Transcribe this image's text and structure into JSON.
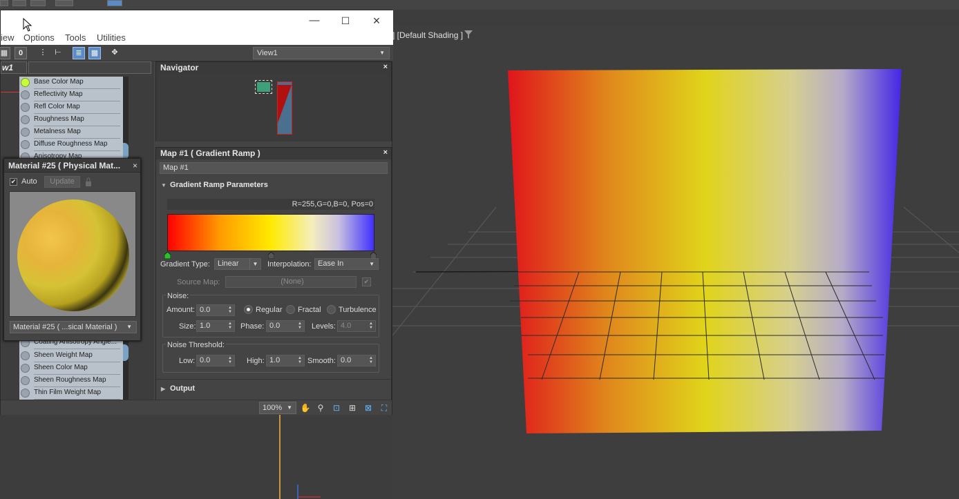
{
  "app": {
    "viewport_label": "] [Default Shading ]",
    "axis_label": "z"
  },
  "slate": {
    "menu": [
      "iew",
      "Options",
      "Tools",
      "Utilities"
    ],
    "toolbar_zero": "0",
    "view_select": "View1",
    "view_tab": "w1"
  },
  "node_slots_top": [
    "Base Color Map",
    "Reflectivity Map",
    "Refl Color Map",
    "Roughness Map",
    "Metalness Map",
    "Diffuse Roughness Map",
    "Anisotropy Map"
  ],
  "node_slots_bottom": [
    "Coating Anisotropy Angle...",
    "Sheen Weight Map",
    "Sheen Color Map",
    "Sheen Roughness Map",
    "Thin Film Weight Map"
  ],
  "material_window": {
    "title": "Material #25  ( Physical Mat...",
    "auto_label": "Auto",
    "auto_checked": true,
    "update_label": "Update",
    "material_select": "Material #25  ( ...sical Material )"
  },
  "navigator": {
    "title": "Navigator"
  },
  "map_panel": {
    "title": "Map #1  ( Gradient Ramp )",
    "map_name": "Map #1",
    "rollout_params": "Gradient Ramp Parameters",
    "flag_info": "R=255,G=0,B=0, Pos=0",
    "gradient_type_label": "Gradient Type:",
    "gradient_type_value": "Linear",
    "interpolation_label": "Interpolation:",
    "interpolation_value": "Ease In",
    "source_map_label": "Source Map:",
    "source_map_value": "(None)",
    "noise_label": "Noise:",
    "amount_label": "Amount:",
    "amount_value": "0.0",
    "regular_label": "Regular",
    "fractal_label": "Fractal",
    "turbulence_label": "Turbulence",
    "noise_type_selected": "Regular",
    "size_label": "Size:",
    "size_value": "1.0",
    "phase_label": "Phase:",
    "phase_value": "0.0",
    "levels_label": "Levels:",
    "levels_value": "4.0",
    "threshold_label": "Noise Threshold:",
    "low_label": "Low:",
    "low_value": "0.0",
    "high_label": "High:",
    "high_value": "1.0",
    "smooth_label": "Smooth:",
    "smooth_value": "0.0",
    "rollout_output": "Output"
  },
  "status": {
    "zoom": "100%"
  },
  "colors": {
    "gradient_start": "#ff0000",
    "gradient_mid": "#ffea00",
    "gradient_end": "#4030ff",
    "node_body": "#b9c1cb",
    "active_slot": "#c8ff3c"
  }
}
